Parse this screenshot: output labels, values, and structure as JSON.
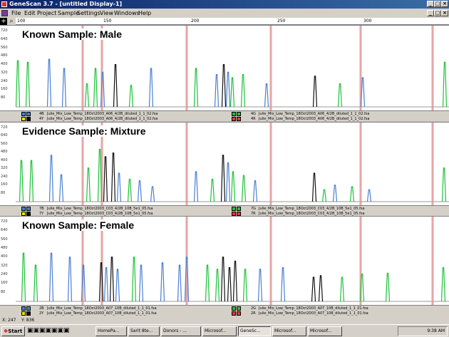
{
  "window": {
    "title": "GeneScan 3.7 - [untitled Display-1]",
    "buttons": [
      "_",
      "□",
      "×"
    ]
  },
  "menu": [
    "File",
    "Edit",
    "Project",
    "Sample",
    "Settings",
    "View",
    "Windows",
    "Help"
  ],
  "ruler": {
    "labels": [
      "100",
      "150",
      "200",
      "250",
      "300"
    ]
  },
  "panels": [
    {
      "title": "Known Sample: Male",
      "y_labels": [
        "720",
        "640",
        "560",
        "480",
        "400",
        "320",
        "240",
        "160",
        "80"
      ],
      "legend": [
        {
          "id": "4B",
          "file": "Julie_Mix_Low_Temp_18Oct2003_A06_4/2B_diluted_1_1_02.fsa"
        },
        {
          "id": "4Y",
          "file": "Julie_Mix_Low_Temp_18Oct2003_A06_4/2B_diluted_1_1_02.fsa"
        },
        {
          "id": "4G",
          "file": "Julie_Mix_Low_Temp_18Oct2003_A06_4/2B_diluted_1_1_02.fsa"
        },
        {
          "id": "4R",
          "file": "Julie_Mix_Low_Temp_18Oct2003_A06_4/2B_diluted_1_1_02.fsa"
        }
      ]
    },
    {
      "title": "Evidence Sample: Mixture",
      "y_labels": [
        "720",
        "640",
        "560",
        "480",
        "400",
        "320",
        "240",
        "160",
        "80"
      ],
      "legend": [
        {
          "id": "7B",
          "file": "Julie_Mix_Low_Temp_18Oct2003_C03_4/2B_10B_5e1_05.fsa"
        },
        {
          "id": "7Y",
          "file": "Julie_Mix_Low_Temp_18Oct2003_C03_4/2B_10B_5e1_05.fsa"
        },
        {
          "id": "7G",
          "file": "Julie_Mix_Low_Temp_18Oct2003_C03_4/2B_10B_5e1_05.fsa"
        },
        {
          "id": "7R",
          "file": "Julie_Mix_Low_Temp_18Oct2003_C03_4/2B_10B_5e1_05.fsa"
        }
      ]
    },
    {
      "title": "Known Sample: Female",
      "y_labels": [
        "720",
        "640",
        "560",
        "480",
        "400",
        "320",
        "240",
        "160",
        "80"
      ],
      "legend": [
        {
          "id": "2B",
          "file": "Julie_Mix_Low_Temp_18Oct2003_A07_10B_diluted_1_1_01.fsa"
        },
        {
          "id": "2Y",
          "file": "Julie_Mix_Low_Temp_18Oct2003_A07_10B_diluted_1_1_01.fsa"
        },
        {
          "id": "2G",
          "file": "Julie_Mix_Low_Temp_18Oct2003_A07_10B_diluted_1_1_01.fsa"
        },
        {
          "id": "2R",
          "file": "Julie_Mix_Low_Temp_18Oct2003_A07_10B_diluted_1_1_01.fsa"
        }
      ]
    }
  ],
  "status": {
    "x": "X: 247",
    "y": "Y: 836"
  },
  "taskbar": {
    "start": "Start",
    "items": [
      "HomePa...",
      "Sarit 8te...",
      "Donors - ...",
      "Microsof...",
      "GeneSc...",
      "Microsof...",
      "Microsof..."
    ],
    "clock": "9:38 AM"
  },
  "colors": {
    "blue": "#4a7fd4",
    "green": "#1fc23a",
    "black": "#111111",
    "red": "#e03a3a",
    "marker": "#e09090"
  }
}
